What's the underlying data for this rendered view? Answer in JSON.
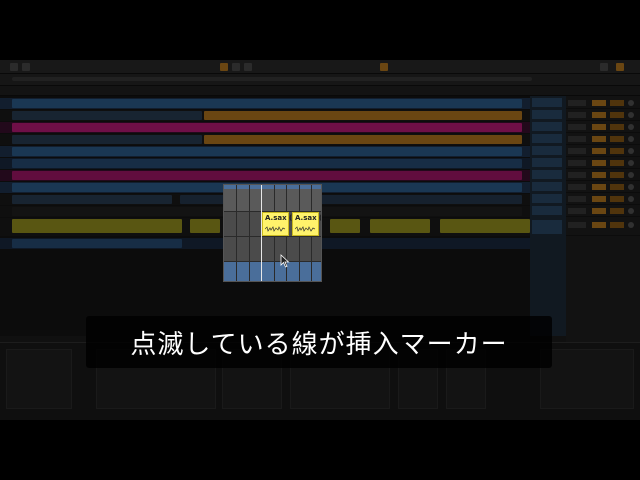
{
  "caption": {
    "text": "点滅している線が挿入マーカー"
  },
  "zoom": {
    "clips": [
      {
        "label": "A.sax (",
        "color": "#fff36b"
      },
      {
        "label": "A.sax (",
        "color": "#fff36b"
      }
    ]
  },
  "colors": {
    "background": "#1c1c1c",
    "accent_orange": "#b7791f",
    "track_blue": "#2e5f8f",
    "track_magenta": "#c01a7a",
    "clip_yellow": "#fff36b",
    "selection_blue": "#4a6e9a"
  },
  "icons": {
    "cursor": "mouse-pointer-icon"
  }
}
